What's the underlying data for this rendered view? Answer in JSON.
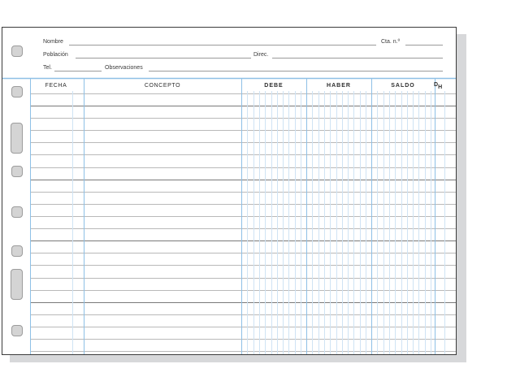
{
  "form": {
    "header": {
      "nombre_label": "Nombre",
      "cta_label": "Cta. n.º",
      "poblacion_label": "Población",
      "direc_label": "Direc.",
      "tel_label": "Tel.",
      "observaciones_label": "Observaciones"
    },
    "columns": {
      "fecha": "FECHA",
      "concepto": "CONCEPTO",
      "debe": "DEBE",
      "haber": "HABER",
      "saldo": "SALDO",
      "dh_top": "D",
      "dh_bottom": "H"
    },
    "colors": {
      "blue_rule": "#8ec0e6",
      "light_blue_rule": "#cfe3f4",
      "gray_rule": "#b9b9b9",
      "dark_rule": "#7a7a7a",
      "hole_fill": "#d4d4d4"
    }
  }
}
